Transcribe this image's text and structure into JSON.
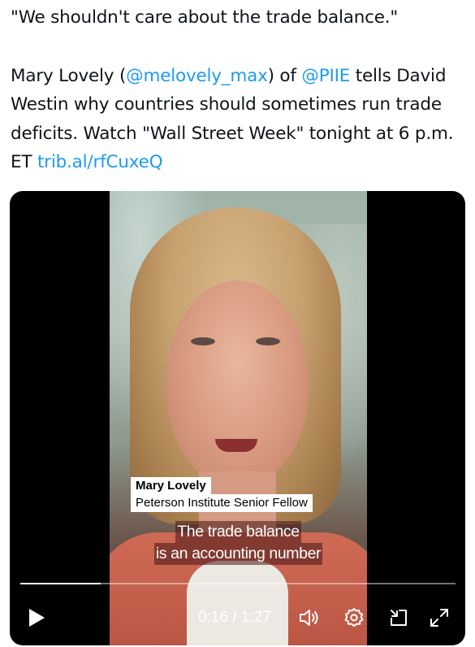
{
  "tweet": {
    "line1": "\"We shouldn't care about the trade balance.\"",
    "p2_part1": "Mary Lovely (",
    "mention1": "@melovely_max",
    "p2_part2": ") of ",
    "mention2": "@PIIE",
    "p2_part3": " tells David Westin why countries should sometimes run trade deficits. Watch \"Wall Street Week\" tonight at 6 p.m. ET ",
    "link": "trib.al/rfCuxeQ"
  },
  "video": {
    "lower_third_name": "Mary Lovely",
    "lower_third_title": "Peterson Institute Senior Fellow",
    "caption_line1": "The trade balance",
    "caption_line2": "is an accounting number",
    "current_time": "0:16",
    "duration": "1:27",
    "time_separator": " / ",
    "progress_fraction": 0.184,
    "icons": [
      "play-icon",
      "volume-icon",
      "settings-gear-icon",
      "dock-icon",
      "fullscreen-icon"
    ]
  },
  "colors": {
    "link": "#1d9bf0",
    "text": "#0f1419"
  }
}
